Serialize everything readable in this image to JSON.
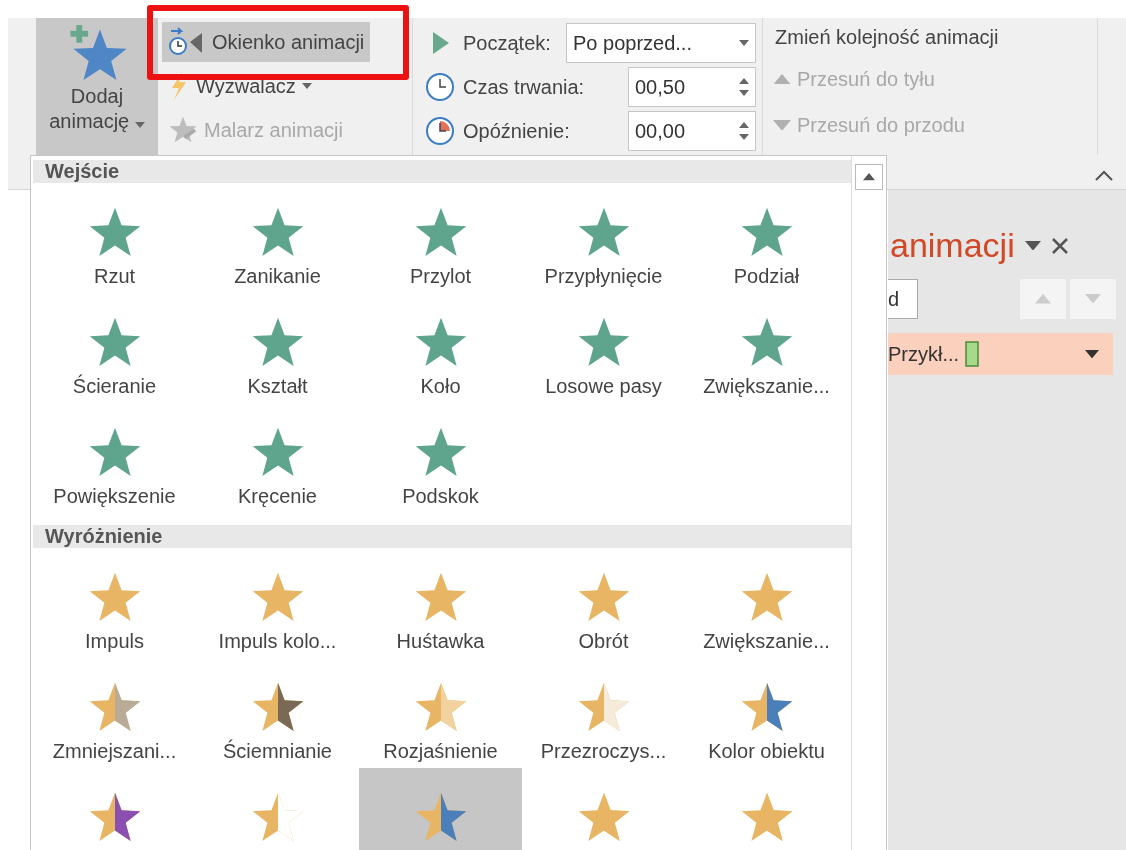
{
  "ribbon": {
    "add_animation": {
      "label": "Dodaj animację",
      "expanded": true
    },
    "advanced": [
      {
        "label": "Okienko animacji",
        "kind": "pane",
        "highlighted": true,
        "disabled": false,
        "has_menu": false
      },
      {
        "label": "Wyzwalacz",
        "kind": "trigger",
        "highlighted": false,
        "disabled": false,
        "has_menu": true
      },
      {
        "label": "Malarz animacji",
        "kind": "painter",
        "highlighted": false,
        "disabled": true,
        "has_menu": false
      }
    ],
    "timing": [
      {
        "kind": "start",
        "label": "Początek:",
        "value": "Po poprzed..."
      },
      {
        "kind": "duration",
        "label": "Czas trwania:",
        "value": "00,50"
      },
      {
        "kind": "delay",
        "label": "Opóźnienie:",
        "value": "00,00"
      }
    ],
    "reorder": {
      "title": "Zmień kolejność animacji",
      "buttons": [
        {
          "label": "Przesuń do tyłu",
          "kind": "move_back",
          "disabled": true
        },
        {
          "label": "Przesuń do przodu",
          "kind": "move_forward",
          "disabled": true
        }
      ]
    }
  },
  "pane": {
    "title": "animacji",
    "field_value": "d",
    "row_label": "Przykł..."
  },
  "gallery": {
    "sections": [
      {
        "title": "Wejście",
        "kind": "entrance",
        "items": [
          {
            "label": "Rzut",
            "selected": false
          },
          {
            "label": "Zanikanie",
            "selected": false
          },
          {
            "label": "Przylot",
            "selected": false
          },
          {
            "label": "Przypłynięcie",
            "selected": false
          },
          {
            "label": "Podział",
            "selected": false
          },
          {
            "label": "Ścieranie",
            "selected": false
          },
          {
            "label": "Kształt",
            "selected": false
          },
          {
            "label": "Koło",
            "selected": false
          },
          {
            "label": "Losowe pasy",
            "selected": false
          },
          {
            "label": "Zwiększanie...",
            "selected": false
          },
          {
            "label": "Powiększenie",
            "selected": false
          },
          {
            "label": "Kręcenie",
            "selected": false
          },
          {
            "label": "Podskok",
            "selected": false
          }
        ]
      },
      {
        "title": "Wyróżnienie",
        "kind": "emphasis",
        "items": [
          {
            "label": "Impuls",
            "selected": false
          },
          {
            "label": "Impuls kolo...",
            "selected": false
          },
          {
            "label": "Huśtawka",
            "selected": false
          },
          {
            "label": "Obrót",
            "selected": false
          },
          {
            "label": "Zwiększanie...",
            "selected": false
          },
          {
            "label": "Zmniejszani...",
            "selected": false
          },
          {
            "label": "Ściemnianie",
            "selected": false
          },
          {
            "label": "Rozjaśnienie",
            "selected": false
          },
          {
            "label": "Przezroczys...",
            "selected": false
          },
          {
            "label": "Kolor obiektu",
            "selected": false
          },
          {
            "selected": false
          },
          {
            "selected": false
          },
          {
            "selected": true
          },
          {
            "selected": false
          },
          {
            "selected": false
          }
        ]
      }
    ]
  }
}
